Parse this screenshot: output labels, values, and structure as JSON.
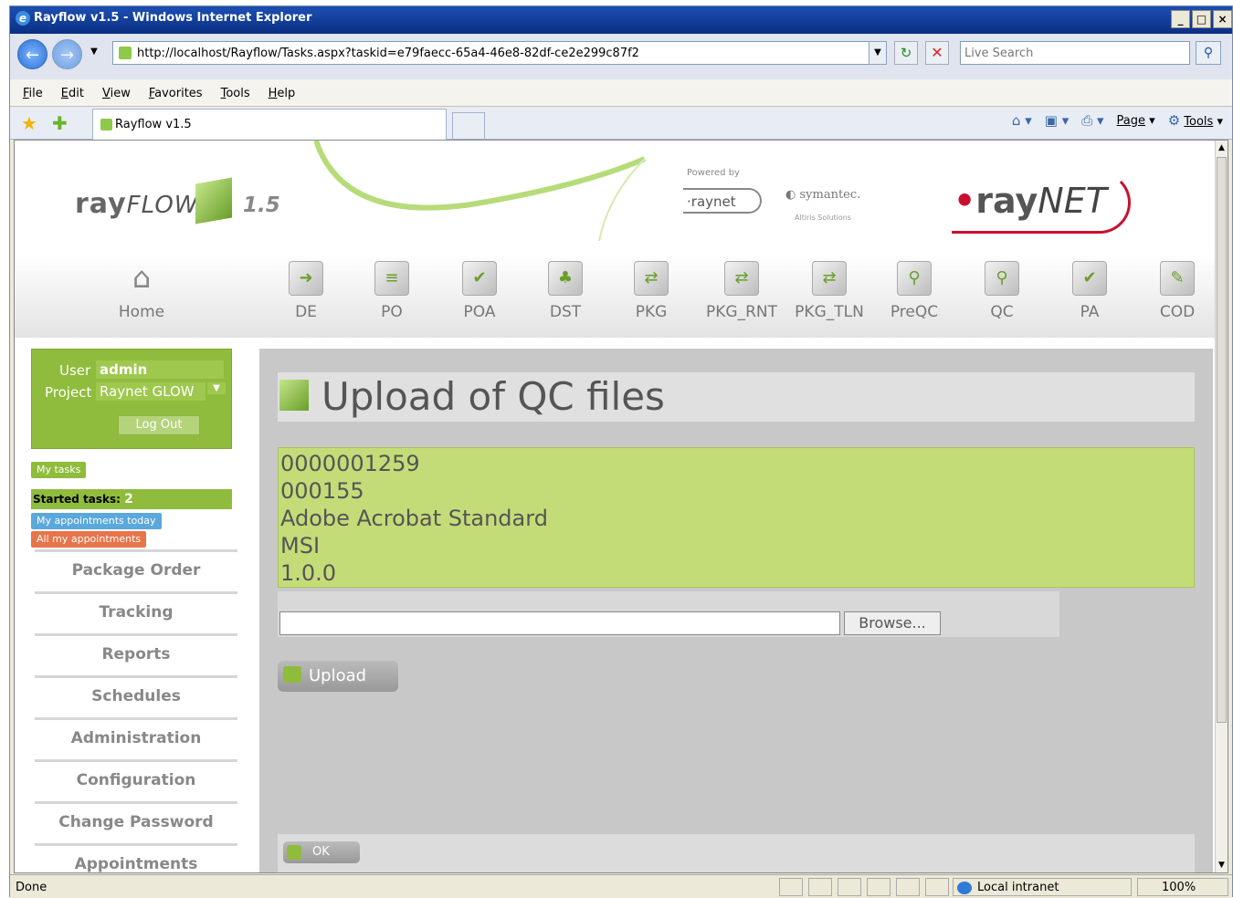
{
  "window": {
    "title": "Rayflow v1.5 - Windows Internet Explorer"
  },
  "address": {
    "url": "http://localhost/Rayflow/Tasks.aspx?taskid=e79faecc-65a4-46e8-82df-ce2e299c87f2",
    "search_placeholder": "Live Search"
  },
  "menu": [
    "File",
    "Edit",
    "View",
    "Favorites",
    "Tools",
    "Help"
  ],
  "tab": {
    "title": "Rayflow v1.5"
  },
  "command_bar": {
    "page": "Page",
    "tools": "Tools"
  },
  "header": {
    "logo": "ray",
    "logo_italic": "FLOW",
    "version": "1.5",
    "powered_by": "Powered by",
    "partner1": "raynet",
    "partner2": "symantec.",
    "partner2_sub": "Altiris Solutions",
    "brand": "ray",
    "brand_italic": "NET"
  },
  "nav": [
    {
      "label": "Home",
      "icon": "home-icon"
    },
    {
      "label": "DE",
      "icon": "import-icon"
    },
    {
      "label": "PO",
      "icon": "document-icon"
    },
    {
      "label": "POA",
      "icon": "check-document-icon"
    },
    {
      "label": "DST",
      "icon": "distribute-icon"
    },
    {
      "label": "PKG",
      "icon": "package-icon"
    },
    {
      "label": "PKG_RNT",
      "icon": "package-icon"
    },
    {
      "label": "PKG_TLN",
      "icon": "package-icon"
    },
    {
      "label": "PreQC",
      "icon": "magnifier-icon"
    },
    {
      "label": "QC",
      "icon": "magnifier-icon"
    },
    {
      "label": "PA",
      "icon": "approve-icon"
    },
    {
      "label": "COD",
      "icon": "pen-icon"
    }
  ],
  "user": {
    "user_label": "User",
    "user": "admin",
    "project_label": "Project",
    "project": "Raynet GLOW",
    "logout": "Log Out"
  },
  "tasks": {
    "my_tasks": "My tasks",
    "started_label": "Started tasks:",
    "started_count": "2",
    "appointments_today": "My appointments today",
    "all_appointments": "All my appointments"
  },
  "left_menu": [
    "Package Order",
    "Tracking",
    "Reports",
    "Schedules",
    "Administration",
    "Configuration",
    "Change Password",
    "Appointments"
  ],
  "panel": {
    "title": "Upload of QC files",
    "info": [
      "0000001259",
      "000155",
      "Adobe Acrobat Standard",
      "MSI",
      "1.0.0"
    ],
    "browse": "Browse...",
    "upload": "Upload",
    "ok": "OK"
  },
  "status": {
    "text": "Done",
    "zone": "Local intranet",
    "zoom": "100%"
  }
}
